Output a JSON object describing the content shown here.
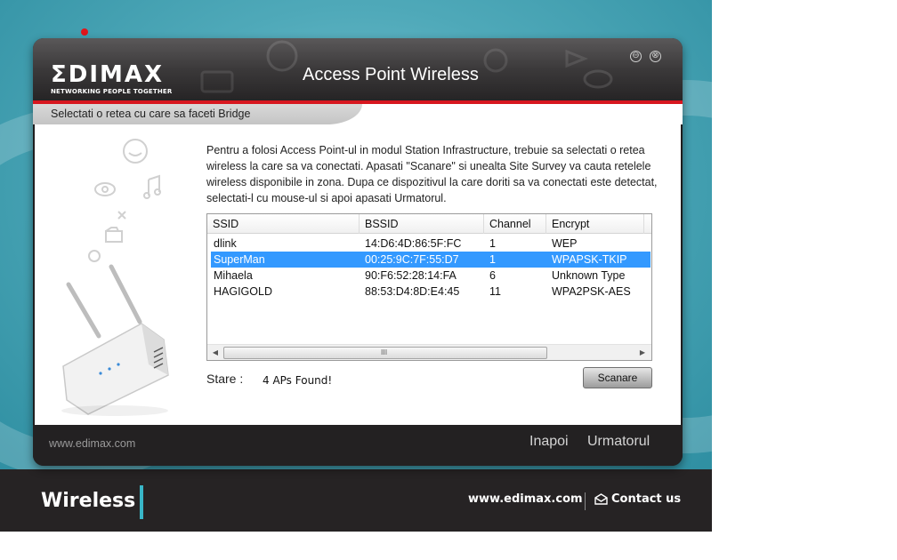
{
  "background": {
    "brand_label": "Wireless",
    "footer_url": "www.edimax.com",
    "contact_label": "Contact us",
    "accent_color": "#39b6c8"
  },
  "window": {
    "logo_text": "ΣDIMAX",
    "logo_tagline": "NETWORKING PEOPLE TOGETHER",
    "title": "Access Point Wireless",
    "minimize_icon": "⊖",
    "close_icon": "⊗",
    "accent_color": "#d7171f"
  },
  "subheader": {
    "label": "Selectati o retea cu care sa faceti Bridge"
  },
  "instructions": "Pentru a folosi Access Point-ul in modul Station Infrastructure, trebuie sa selectati o retea wireless la care sa va conectati. Apasati \"Scanare\" si unealta Site Survey va cauta retelele wireless disponibile in zona. Dupa ce dispozitivul la care doriti sa va conectati este detectat, selectati-l cu mouse-ul si apoi apasati Urmatorul.",
  "table": {
    "headers": [
      "SSID",
      "BSSID",
      "Channel",
      "Encrypt"
    ],
    "rows": [
      {
        "ssid": "dlink",
        "bssid": "14:D6:4D:86:5F:FC",
        "channel": "1",
        "encrypt": "WEP"
      },
      {
        "ssid": "SuperMan",
        "bssid": "00:25:9C:7F:55:D7",
        "channel": "1",
        "encrypt": "WPAPSK-TKIP"
      },
      {
        "ssid": "Mihaela",
        "bssid": "90:F6:52:28:14:FA",
        "channel": "6",
        "encrypt": "Unknown Type"
      },
      {
        "ssid": "HAGIGOLD",
        "bssid": "88:53:D4:8D:E4:45",
        "channel": "11",
        "encrypt": "WPA2PSK-AES"
      }
    ],
    "selected_row": 1,
    "selection_color": "#3399ff",
    "scroll_left_icon": "◀",
    "scroll_right_icon": "▶",
    "scroll_grip": "III"
  },
  "status": {
    "label": "Stare :",
    "value": "4 APs Found!"
  },
  "scan_button": "Scanare",
  "footer": {
    "url": "www.edimax.com",
    "back_label": "Inapoi",
    "next_label": "Urmatorul"
  }
}
